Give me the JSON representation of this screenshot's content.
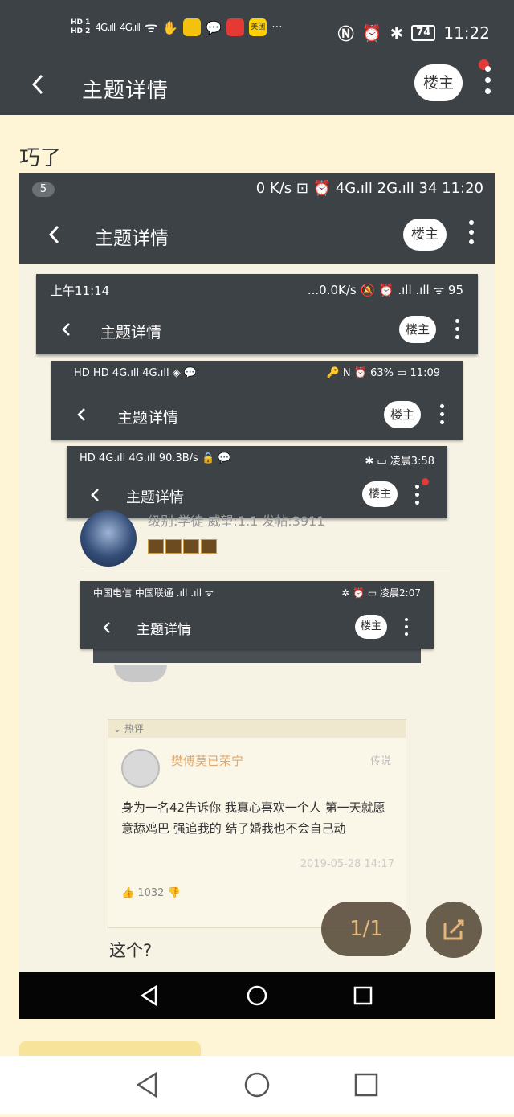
{
  "status_bar": {
    "hd_top": "HD 1",
    "hd_bottom": "HD 2",
    "signal1": "4G",
    "signal2": "4G",
    "app_label": "美团",
    "more": "···",
    "battery": "74",
    "time": "11:22"
  },
  "app_bar": {
    "title": "主题详情",
    "louzhu_label": "楼主"
  },
  "post": {
    "text": "巧了"
  },
  "screenshot": {
    "status_bar": {
      "badge": "5",
      "right": "0 K/s  ⊡  ⏰  4G.ıll  2G.ıll  34  11:20"
    },
    "title": "主题详情",
    "louzhu_label": "楼主",
    "nested": [
      {
        "status_left": "上午11:14",
        "status_right": "...0.0K/s  🔕 ⏰ .ıll .ıll ᯤ 95",
        "title": "主题详情",
        "louzhu": "楼主"
      },
      {
        "status_left": "HD HD  4G.ıll 4G.ıll ◈ 💬",
        "status_right": "🔑 N ⏰ 63% ▭ 11:09",
        "title": "主题详情",
        "louzhu": "楼主"
      },
      {
        "status_left": "HD 4G.ıll 4G.ıll 90.3B/s 🔒 💬",
        "status_right": "✱ ▭ 凌晨3:58",
        "title": "主题详情",
        "louzhu": "楼主"
      },
      {
        "status_left": "中国电信 中国联通 .ıll .ıll ᯤ",
        "status_right": "✲ ⏰ ▭ 凌晨2:07",
        "title": "主题详情",
        "louzhu": "楼主"
      }
    ],
    "profile_line": "级别:学徒   威望:1.1   发帖:3911",
    "hot_comment": {
      "header": "⌄ 热评",
      "user": "樊傅莫已荣宁",
      "tag": "传说",
      "body": "身为一名42告诉你 我真心喜欢一个人 第一天就愿意舔鸡巴 强追我的 结了婚我也不会自己动",
      "time": "2019-05-28 14:17",
      "likes": "1032"
    },
    "followup": "这个?",
    "page_indicator": "1/1"
  },
  "colors": {
    "bar": "#3d4247",
    "background": "#fdf5d6",
    "accent": "#e3b57a"
  }
}
